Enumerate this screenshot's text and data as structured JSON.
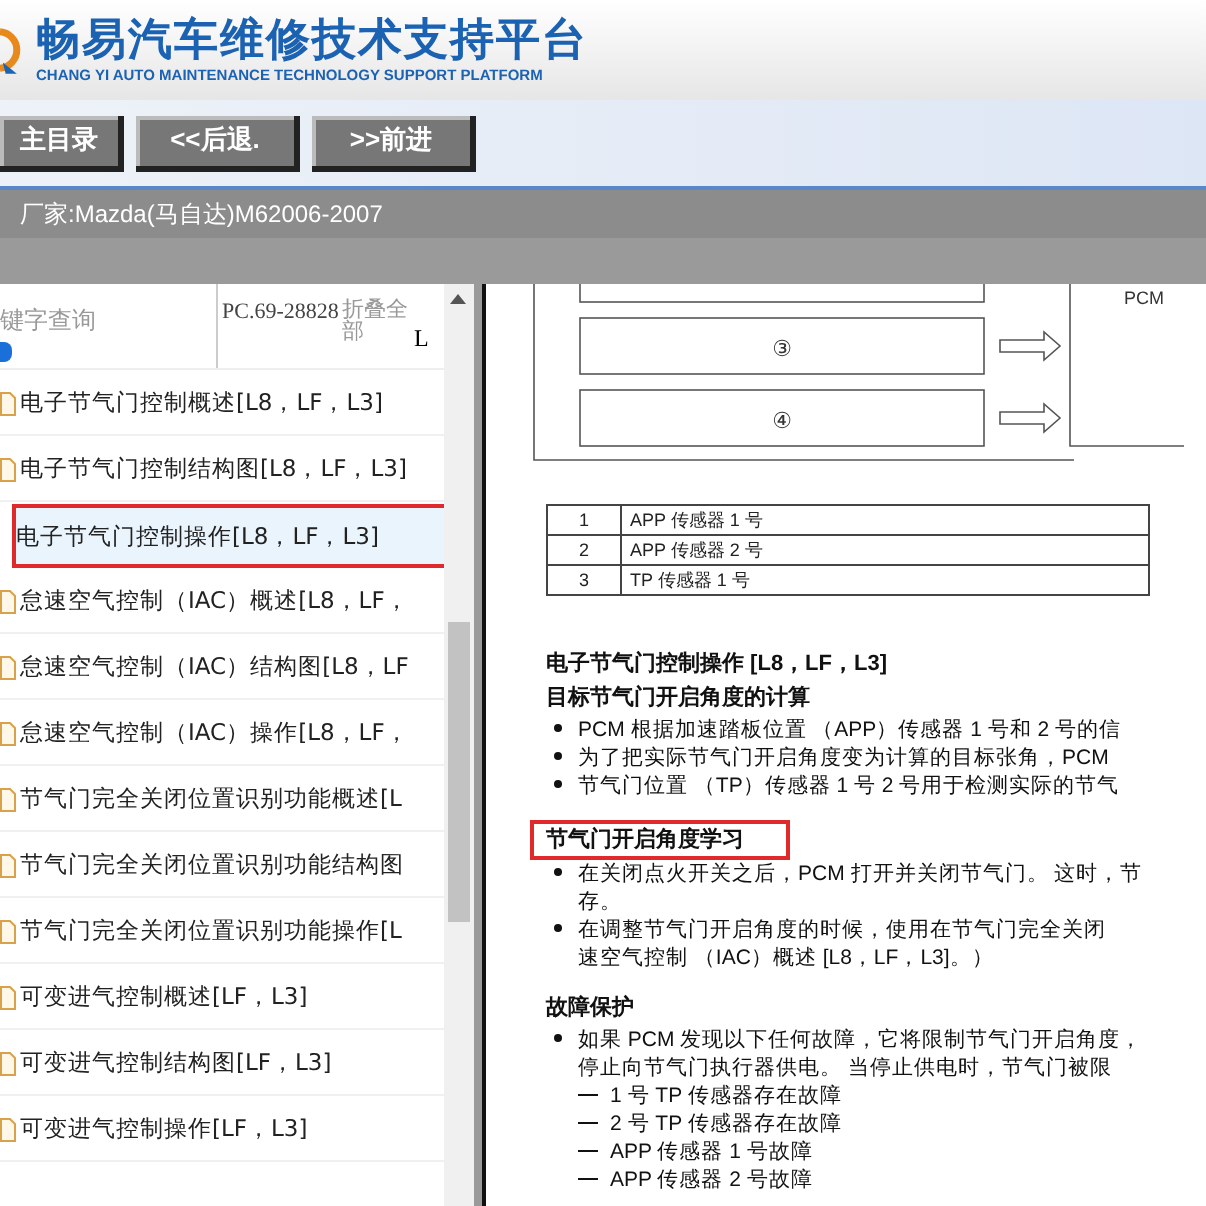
{
  "header": {
    "title": "畅易汽车维修技术支持平台",
    "subtitle": "CHANG YI AUTO MAINTENANCE TECHNOLOGY SUPPORT PLATFORM"
  },
  "nav_buttons": [
    "主目录",
    "<<后退.",
    ">>前进"
  ],
  "breadcrumb": "厂家:Mazda(马自达)M62006-2007",
  "sidebar": {
    "search_label": "键字查询",
    "code": "PC.69-28828",
    "collapse": "折叠全部",
    "column_4": "L",
    "items": [
      {
        "label": "电子节气门控制概述[L8，LF，L3]",
        "selected": false
      },
      {
        "label": "电子节气门控制结构图[L8，LF，L3]",
        "selected": false
      },
      {
        "label": "电子节气门控制操作[L8，LF，L3]",
        "selected": true
      },
      {
        "label": "怠速空气控制（IAC）概述[L8，LF，",
        "selected": false
      },
      {
        "label": "怠速空气控制（IAC）结构图[L8，LF",
        "selected": false
      },
      {
        "label": "怠速空气控制（IAC）操作[L8，LF，",
        "selected": false
      },
      {
        "label": "节气门完全关闭位置识别功能概述[L",
        "selected": false
      },
      {
        "label": "节气门完全关闭位置识别功能结构图",
        "selected": false
      },
      {
        "label": "节气门完全关闭位置识别功能操作[L",
        "selected": false
      },
      {
        "label": "可变进气控制概述[LF，L3]",
        "selected": false
      },
      {
        "label": "可变进气控制结构图[LF，L3]",
        "selected": false
      },
      {
        "label": "可变进气控制操作[LF，L3]",
        "selected": false
      }
    ]
  },
  "document": {
    "diagram": {
      "labels": [
        "③",
        "④"
      ],
      "controller": "PCM"
    },
    "legend": [
      {
        "number": "1",
        "label": "APP 传感器 1 号"
      },
      {
        "number": "2",
        "label": "APP 传感器 2 号"
      },
      {
        "number": "3",
        "label": "TP 传感器 1 号"
      }
    ],
    "lines": [
      {
        "kind": "heading",
        "text": "电子节气门控制操作 [L8，LF，L3]",
        "highlighted": false
      },
      {
        "kind": "heading",
        "text": "目标节气门开启角度的计算",
        "highlighted": false
      },
      {
        "kind": "bullet",
        "text": "PCM 根据加速踏板位置 （APP）传感器 1 号和 2 号的信"
      },
      {
        "kind": "bullet",
        "text": "为了把实际节气门开启角度变为计算的目标张角，PCM"
      },
      {
        "kind": "bullet",
        "text": "节气门位置 （TP）传感器 1 号 2 号用于检测实际的节气"
      },
      {
        "kind": "heading",
        "text": "节气门开启角度学习",
        "highlighted": true
      },
      {
        "kind": "bullet",
        "text": "在关闭点火开关之后，PCM 打开并关闭节气门。 这时，节"
      },
      {
        "kind": "continuation",
        "text": "存。"
      },
      {
        "kind": "bullet",
        "text": "在调整节气门开启角度的时候，使用在节气门完全关闭"
      },
      {
        "kind": "continuation",
        "text": "速空气控制 （IAC）概述 [L8，LF，L3]。）"
      },
      {
        "kind": "heading",
        "text": "故障保护",
        "highlighted": false
      },
      {
        "kind": "bullet",
        "text": "如果 PCM 发现以下任何故障，它将限制节气门开启角度，"
      },
      {
        "kind": "continuation",
        "text": "停止向节气门执行器供电。 当停止供电时，节气门被限"
      },
      {
        "kind": "dash",
        "text": "1 号 TP 传感器存在故障"
      },
      {
        "kind": "dash",
        "text": "2 号 TP 传感器存在故障"
      },
      {
        "kind": "dash",
        "text": "APP 传感器 1 号故障"
      },
      {
        "kind": "dash",
        "text": "APP 传感器 2 号故障"
      }
    ]
  }
}
